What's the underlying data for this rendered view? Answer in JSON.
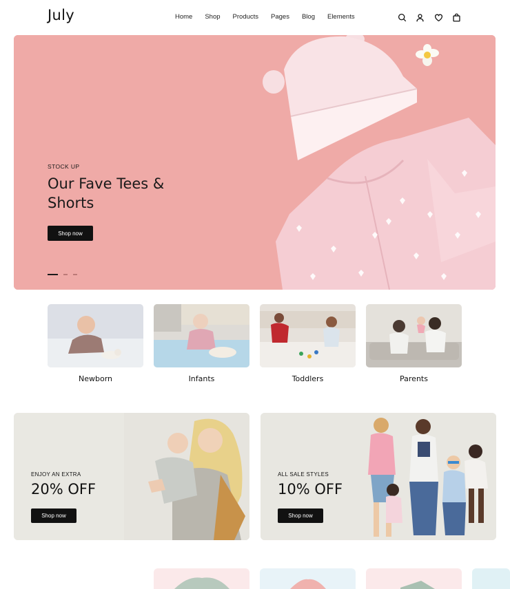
{
  "header": {
    "logo": "July",
    "nav": [
      "Home",
      "Shop",
      "Products",
      "Pages",
      "Blog",
      "Elements"
    ],
    "icons": [
      "search-icon",
      "user-icon",
      "heart-icon",
      "bag-icon"
    ]
  },
  "hero": {
    "eyebrow": "STOCK UP",
    "title": "Our Fave Tees & Shorts",
    "button": "Shop now",
    "slides": 3,
    "active_slide": 1,
    "background": "#eea7a5"
  },
  "categories": [
    {
      "label": "Newborn"
    },
    {
      "label": "Infants"
    },
    {
      "label": "Toddlers"
    },
    {
      "label": "Parents"
    }
  ],
  "promos": [
    {
      "eyebrow": "ENJOY AN EXTRA",
      "title": "20% OFF",
      "button": "Shop now"
    },
    {
      "eyebrow": "ALL SALE STYLES",
      "title": "10% OFF",
      "button": "Shop now"
    }
  ],
  "colors": {
    "accent": "#111111",
    "hero_pink": "#eea7a5",
    "promo_bg": "#e9e8e2"
  }
}
